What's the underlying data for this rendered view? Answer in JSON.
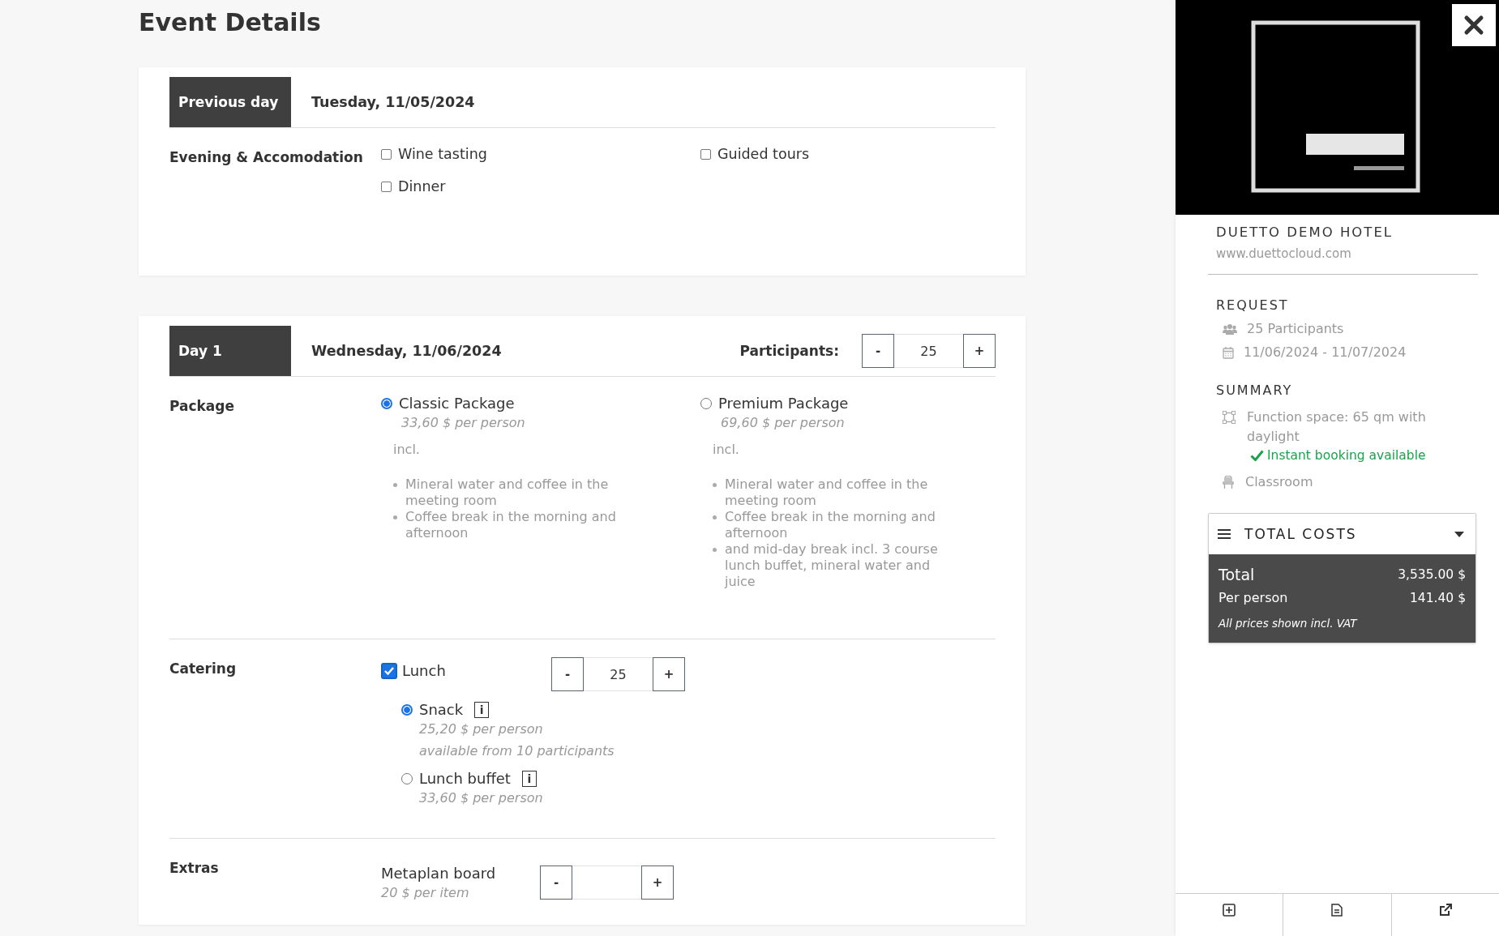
{
  "page_title": "Event Details",
  "days": [
    {
      "tab": "Previous day",
      "date": "Tuesday, 11/05/2024",
      "sections": [
        {
          "kind": "checkboxes",
          "label": "Evening & Accomodation",
          "options": [
            {
              "label": "Wine tasting",
              "checked": false
            },
            {
              "label": "Guided tours",
              "checked": false
            },
            {
              "label": "Dinner",
              "checked": false
            }
          ]
        }
      ]
    },
    {
      "tab": "Day 1",
      "date": "Wednesday, 11/06/2024",
      "participants": {
        "label": "Participants:",
        "minus": "-",
        "value": "25",
        "plus": "+"
      },
      "sections": [
        {
          "kind": "packages",
          "label": "Package",
          "options": [
            {
              "label": "Classic Package",
              "selected": true,
              "price": "33,60 $ per person",
              "incl": "incl.",
              "items": [
                "Mineral water and coffee in the meeting room",
                "Coffee break in the morning and afternoon"
              ]
            },
            {
              "label": "Premium Package",
              "selected": false,
              "price": "69,60 $ per person",
              "incl": "incl.",
              "items": [
                "Mineral water and coffee in the meeting room",
                "Coffee break in the morning and afternoon",
                "and mid-day break incl. 3 course lunch buffet, mineral water and juice"
              ]
            }
          ]
        },
        {
          "kind": "catering",
          "label": "Catering",
          "main": {
            "label": "Lunch",
            "checked": true,
            "stepper": {
              "minus": "-",
              "value": "25",
              "plus": "+"
            }
          },
          "options": [
            {
              "label": "Snack",
              "info": "i",
              "selected": true,
              "price": "25,20 $ per person",
              "note": "available from 10 participants"
            },
            {
              "label": "Lunch buffet",
              "info": "i",
              "selected": false,
              "price": "33,60 $ per person"
            }
          ]
        },
        {
          "kind": "extras",
          "label": "Extras",
          "items": [
            {
              "label": "Metaplan board",
              "price": "20 $ per item",
              "stepper": {
                "minus": "-",
                "plus": "+"
              }
            }
          ]
        }
      ]
    }
  ],
  "sidebar": {
    "hotel_name": "DUETTO DEMO HOTEL",
    "website": "www.duettocloud.com",
    "request": {
      "heading": "REQUEST",
      "items": [
        {
          "kind": "participants",
          "text": "25 Participants"
        },
        {
          "kind": "dates",
          "text": "11/06/2024 - 11/07/2024"
        }
      ]
    },
    "summary": {
      "heading": "SUMMARY",
      "items": [
        {
          "kind": "space",
          "text": "Function space: 65 qm with daylight"
        },
        {
          "kind": "booking",
          "text": "Instant booking available"
        },
        {
          "kind": "layout",
          "text": "Classroom"
        }
      ]
    },
    "costs": {
      "title": "TOTAL COSTS",
      "expanded": true,
      "rows": [
        {
          "kind": "total",
          "label": "Total",
          "amount": "3,535.00 $"
        },
        {
          "kind": "per_person",
          "label": "Per person",
          "amount": "141.40 $"
        }
      ],
      "note": "All prices shown incl. VAT"
    }
  }
}
